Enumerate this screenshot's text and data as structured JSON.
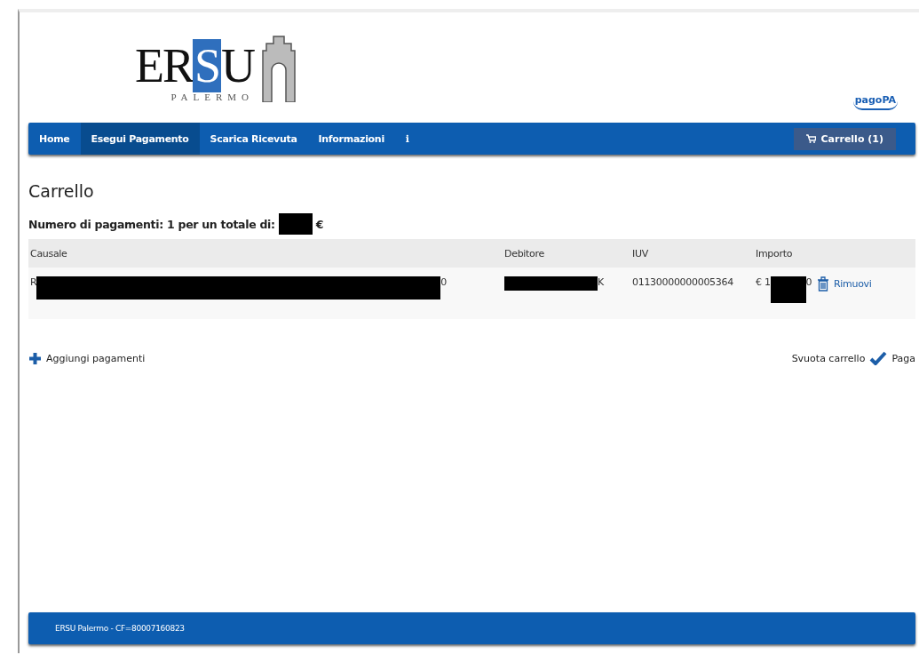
{
  "logo": {
    "wordmark_start": "ER",
    "wordmark_highlight": "S",
    "wordmark_end": "U",
    "city": "PALERMO"
  },
  "partner_logo": "pagoPA",
  "nav": {
    "items": [
      {
        "label": "Home",
        "selected": false
      },
      {
        "label": "Esegui Pagamento",
        "selected": true
      },
      {
        "label": "Scarica Ricevuta",
        "selected": false
      },
      {
        "label": "Informazioni",
        "selected": false
      },
      {
        "label": "ℹ",
        "selected": false
      }
    ],
    "cart_button": "Carrello (1)"
  },
  "title": "Carrello",
  "summary": {
    "text": "Numero di pagamenti: 1  per un totale di:",
    "currency": "€"
  },
  "table": {
    "columns": [
      "Causale",
      "Debitore",
      "IUV",
      "Importo"
    ],
    "rows": [
      {
        "causale_start": "R",
        "causale_end": "0",
        "debitore_end": "K",
        "iuv": "01130000000005364",
        "importo_start": "€ 1",
        "importo_end": "0",
        "remove": "Rimuovi"
      }
    ]
  },
  "actions": {
    "add": "Aggiungi pagamenti",
    "clear": "Svuota carrello",
    "pay": "Paga"
  },
  "footer": "ERSU Palermo - CF=80007160823"
}
